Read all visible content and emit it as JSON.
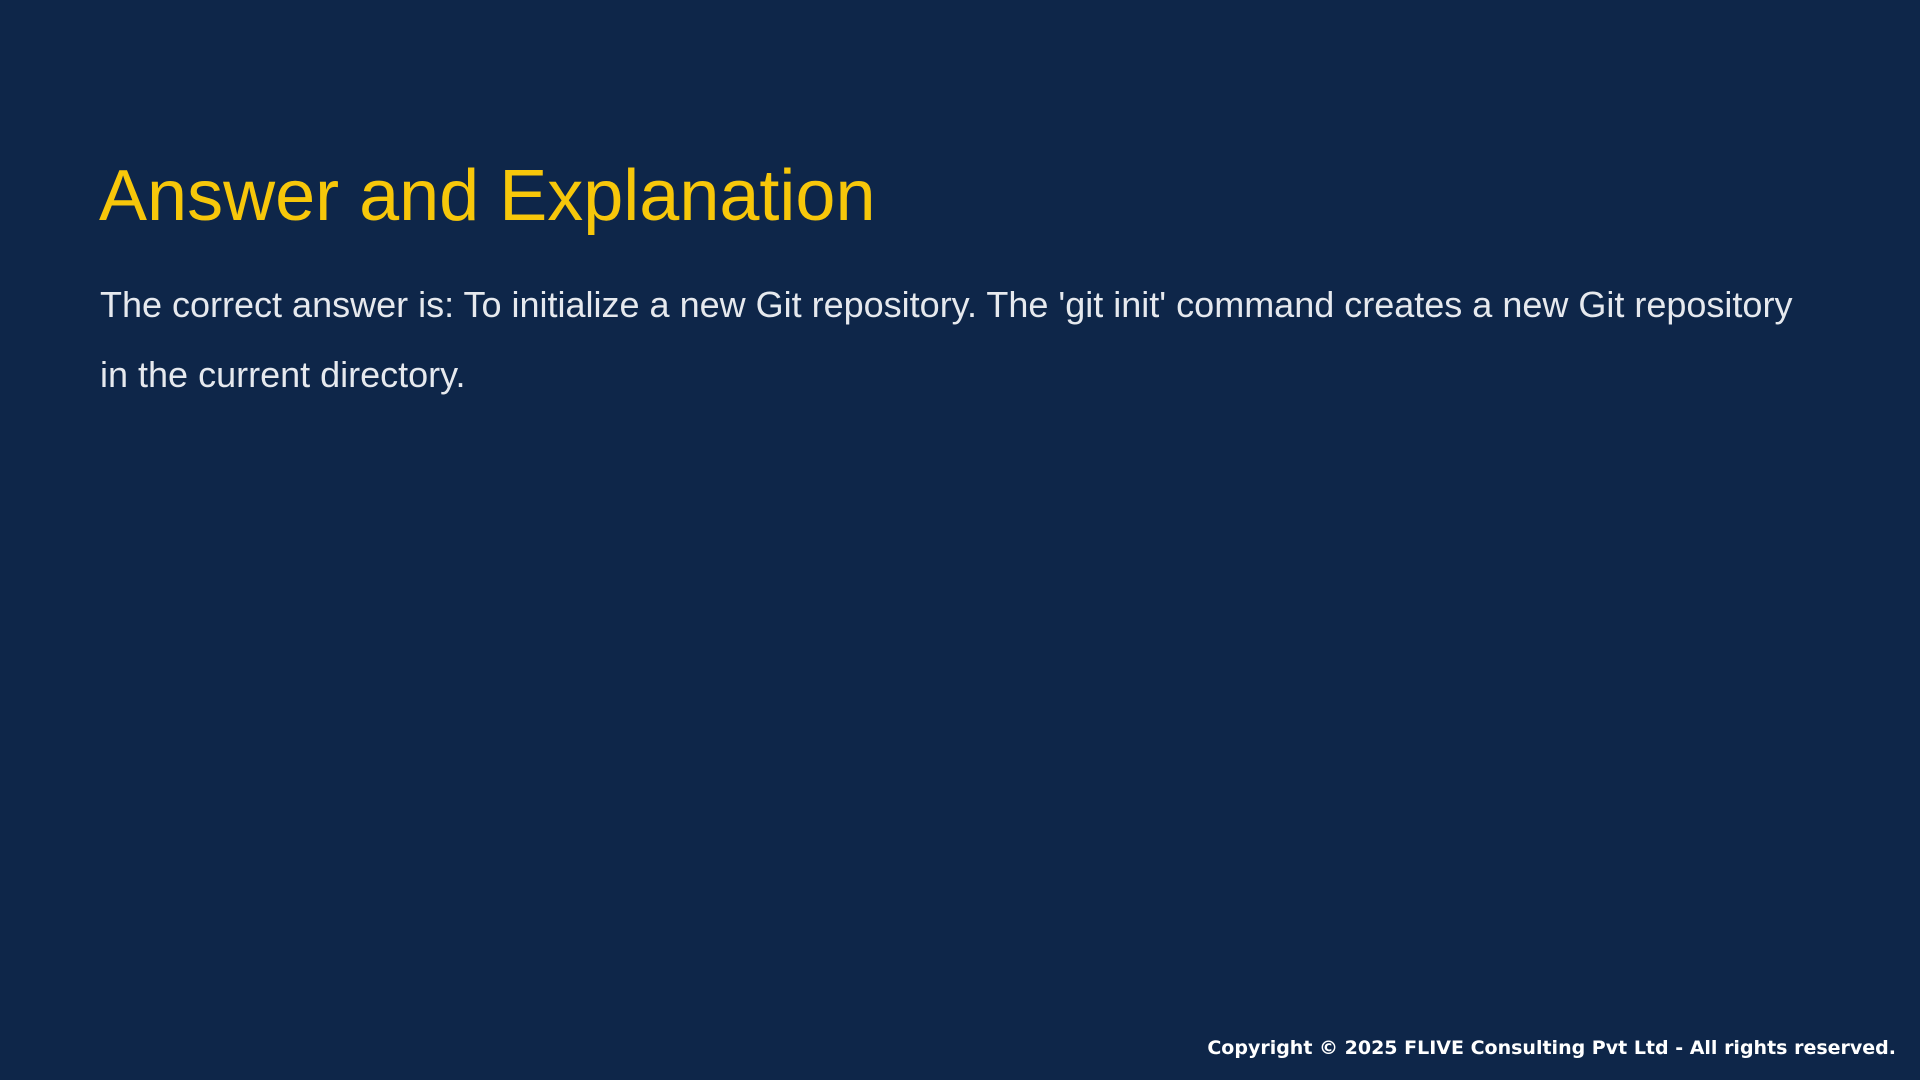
{
  "slide": {
    "title": "Answer and Explanation",
    "body": "The correct answer is: To initialize a new Git repository. The 'git init' command creates a new Git repository in the current directory.",
    "footer": "Copyright © 2025 FLIVE Consulting Pvt Ltd - All rights reserved."
  },
  "colors": {
    "background": "#0e2649",
    "title": "#f7c70a",
    "body": "#e6e9ee",
    "footer": "#ffffff"
  }
}
